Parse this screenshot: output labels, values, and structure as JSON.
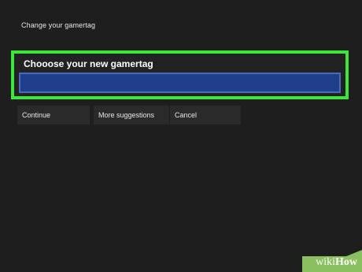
{
  "page": {
    "title": "Change your gamertag"
  },
  "form": {
    "heading": "Chooose your new gamertag",
    "input_value": "",
    "highlight_color": "#3de63a",
    "input_color": "#1f3f8c"
  },
  "buttons": {
    "continue_label": "Continue",
    "more_suggestions_label": "More suggestions",
    "cancel_label": "Cancel"
  },
  "watermark": {
    "brand_wiki": "wiki",
    "brand_how": "How",
    "color": "#8ac060"
  }
}
